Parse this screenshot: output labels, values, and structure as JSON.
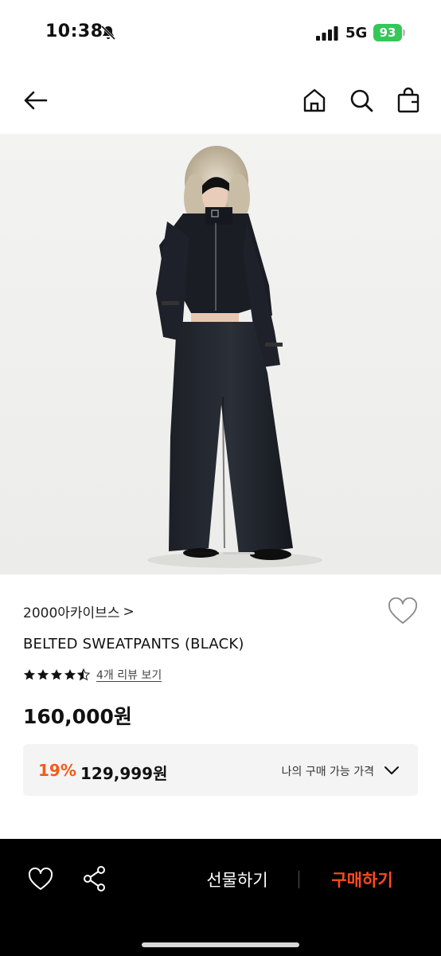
{
  "status_bar": {
    "time": "10:38",
    "network": "5G",
    "battery": "93"
  },
  "nav": {
    "icons": [
      "back-arrow-icon",
      "home-icon",
      "search-icon",
      "shopping-bag-icon"
    ]
  },
  "product": {
    "brand": "2000아카이브스",
    "brand_chevron": ">",
    "title": "BELTED SWEATPANTS (BLACK)",
    "rating_stars": 4.5,
    "review_link": "4개 리뷰 보기",
    "price": "160,000원"
  },
  "discount": {
    "percent": "19%",
    "price": "129,999원",
    "label": "나의 구매 가능 가격"
  },
  "bottom_bar": {
    "gift_label": "선물하기",
    "buy_label": "구매하기"
  },
  "colors": {
    "accent": "#f25c1a",
    "buy": "#ff4b1f",
    "battery": "#34c759"
  },
  "carousel": {
    "total": 2,
    "active": 1
  }
}
